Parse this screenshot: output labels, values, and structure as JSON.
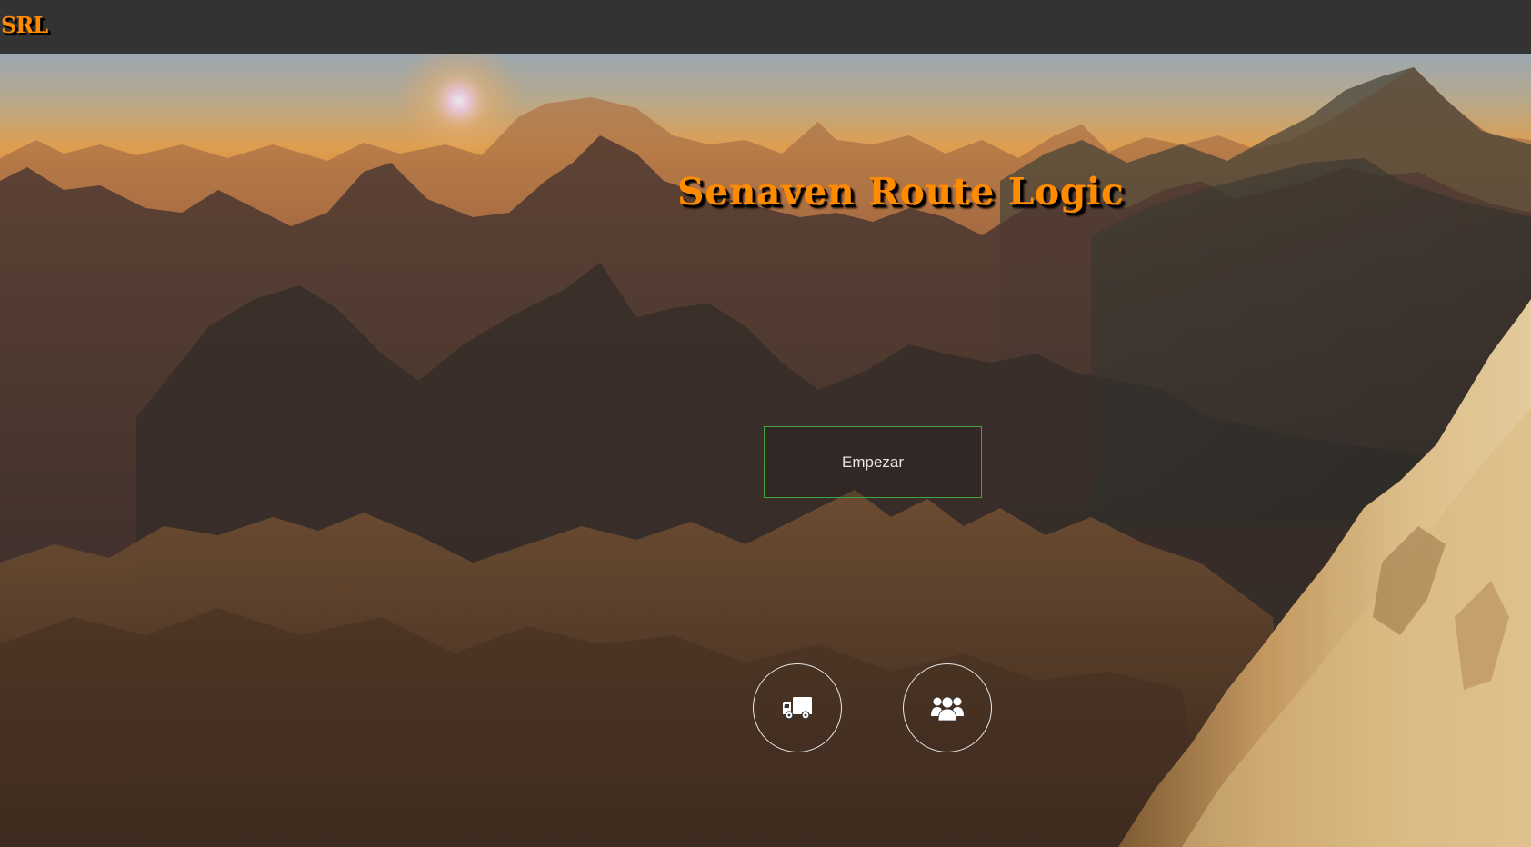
{
  "navbar": {
    "brand_label": "SRL"
  },
  "hero": {
    "title": "Senaven Route Logic",
    "start_label": "Empezar",
    "buttons": [
      {
        "icon": "truck-icon"
      },
      {
        "icon": "users-icon"
      }
    ]
  },
  "colors": {
    "navbar_bg": "#333333",
    "brand": "#ff8c00",
    "button_border": "#3fa53f",
    "icon": "#ffffff"
  }
}
